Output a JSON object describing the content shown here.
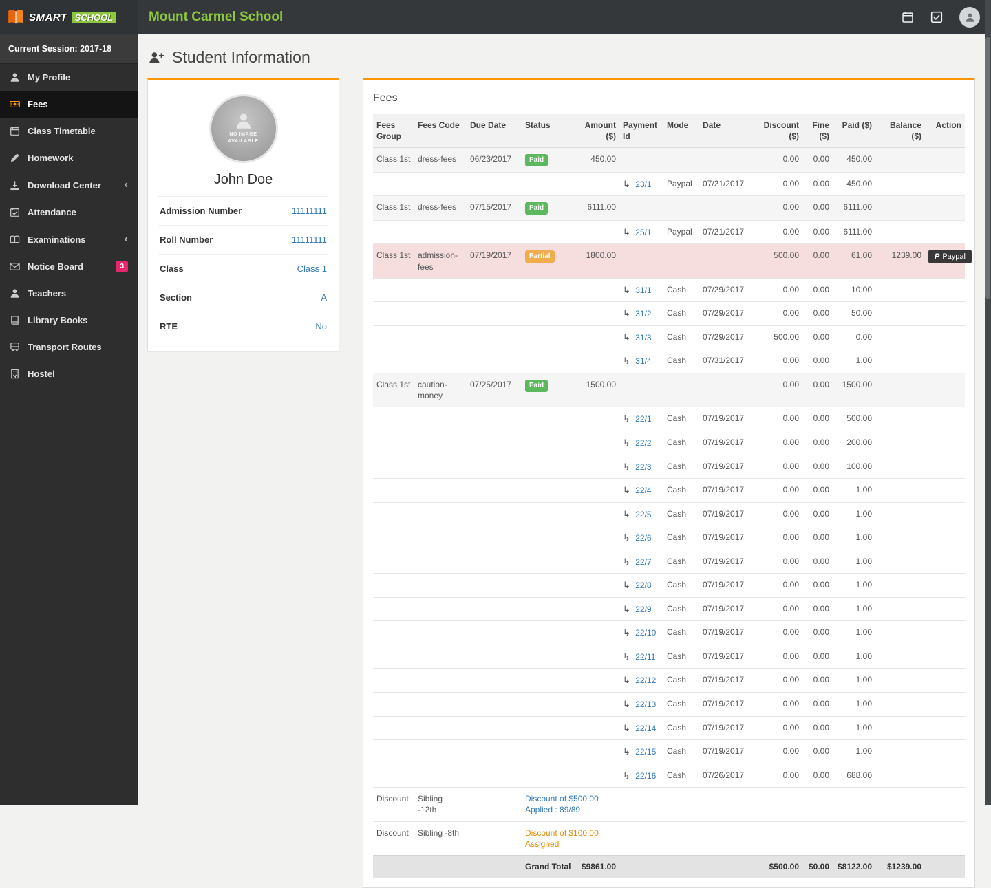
{
  "topbar": {
    "logo_smart": "SMART",
    "logo_school": "SCHOOL",
    "school_name": "Mount Carmel School",
    "icons": [
      "logo-book-icon",
      "calendar-icon",
      "tasks-icon",
      "user-avatar-icon"
    ]
  },
  "sidebar": {
    "session": "Current Session: 2017-18",
    "items": [
      {
        "label": "My Profile",
        "icon": "user-icon",
        "active": false,
        "chevron": false,
        "badge": ""
      },
      {
        "label": "Fees",
        "icon": "fees-icon",
        "active": true,
        "chevron": false,
        "badge": ""
      },
      {
        "label": "Class Timetable",
        "icon": "calendar-icon",
        "active": false,
        "chevron": false,
        "badge": ""
      },
      {
        "label": "Homework",
        "icon": "homework-icon",
        "active": false,
        "chevron": false,
        "badge": ""
      },
      {
        "label": "Download Center",
        "icon": "download-icon",
        "active": false,
        "chevron": true,
        "badge": ""
      },
      {
        "label": "Attendance",
        "icon": "attendance-icon",
        "active": false,
        "chevron": false,
        "badge": ""
      },
      {
        "label": "Examinations",
        "icon": "examinations-icon",
        "active": false,
        "chevron": true,
        "badge": ""
      },
      {
        "label": "Notice Board",
        "icon": "notice-icon",
        "active": false,
        "chevron": false,
        "badge": "3"
      },
      {
        "label": "Teachers",
        "icon": "teachers-icon",
        "active": false,
        "chevron": false,
        "badge": ""
      },
      {
        "label": "Library Books",
        "icon": "library-icon",
        "active": false,
        "chevron": false,
        "badge": ""
      },
      {
        "label": "Transport Routes",
        "icon": "transport-icon",
        "active": false,
        "chevron": false,
        "badge": ""
      },
      {
        "label": "Hostel",
        "icon": "hostel-icon",
        "active": false,
        "chevron": false,
        "badge": ""
      }
    ]
  },
  "page": {
    "title": "Student Information"
  },
  "student": {
    "no_image": "NO IMAGE AVAILABLE",
    "name": "John Doe",
    "fields": [
      {
        "label": "Admission Number",
        "value": "11111111"
      },
      {
        "label": "Roll Number",
        "value": "11111111"
      },
      {
        "label": "Class",
        "value": "Class 1"
      },
      {
        "label": "Section",
        "value": "A"
      },
      {
        "label": "RTE",
        "value": "No"
      }
    ]
  },
  "fees": {
    "title": "Fees",
    "headers": [
      "Fees Group",
      "Fees Code",
      "Due Date",
      "Status",
      "Amount ($)",
      "Payment Id",
      "Mode",
      "Date",
      "Discount ($)",
      "Fine ($)",
      "Paid ($)",
      "Balance ($)",
      "Action"
    ],
    "status_colors": {
      "paid": "#5cb85c",
      "partial": "#f0ad4e"
    },
    "rows": [
      {
        "type": "fee",
        "group": "Class 1st",
        "code": "dress-fees",
        "due_date": "06/23/2017",
        "status": "Paid",
        "status_kind": "paid",
        "amount": "450.00",
        "discount": "0.00",
        "fine": "0.00",
        "paid": "450.00",
        "balance": "",
        "action": "",
        "highlight": false
      },
      {
        "type": "payment",
        "payment_id": "23/1",
        "mode": "Paypal",
        "date": "07/21/2017",
        "discount": "0.00",
        "fine": "0.00",
        "paid": "450.00"
      },
      {
        "type": "fee",
        "group": "Class 1st",
        "code": "dress-fees",
        "due_date": "07/15/2017",
        "status": "Paid",
        "status_kind": "paid",
        "amount": "6111.00",
        "discount": "0.00",
        "fine": "0.00",
        "paid": "6111.00",
        "balance": "",
        "action": "",
        "highlight": false
      },
      {
        "type": "payment",
        "payment_id": "25/1",
        "mode": "Paypal",
        "date": "07/21/2017",
        "discount": "0.00",
        "fine": "0.00",
        "paid": "6111.00"
      },
      {
        "type": "fee",
        "group": "Class 1st",
        "code": "admission-fees",
        "due_date": "07/19/2017",
        "status": "Partial",
        "status_kind": "partial",
        "amount": "1800.00",
        "discount": "500.00",
        "fine": "0.00",
        "paid": "61.00",
        "balance": "1239.00",
        "action": "Paypal",
        "highlight": true
      },
      {
        "type": "payment",
        "payment_id": "31/1",
        "mode": "Cash",
        "date": "07/29/2017",
        "discount": "0.00",
        "fine": "0.00",
        "paid": "10.00"
      },
      {
        "type": "payment",
        "payment_id": "31/2",
        "mode": "Cash",
        "date": "07/29/2017",
        "discount": "0.00",
        "fine": "0.00",
        "paid": "50.00"
      },
      {
        "type": "payment",
        "payment_id": "31/3",
        "mode": "Cash",
        "date": "07/29/2017",
        "discount": "500.00",
        "fine": "0.00",
        "paid": "0.00"
      },
      {
        "type": "payment",
        "payment_id": "31/4",
        "mode": "Cash",
        "date": "07/31/2017",
        "discount": "0.00",
        "fine": "0.00",
        "paid": "1.00"
      },
      {
        "type": "fee",
        "group": "Class 1st",
        "code": "caution-money",
        "due_date": "07/25/2017",
        "status": "Paid",
        "status_kind": "paid",
        "amount": "1500.00",
        "discount": "0.00",
        "fine": "0.00",
        "paid": "1500.00",
        "balance": "",
        "action": "",
        "highlight": false
      },
      {
        "type": "payment",
        "payment_id": "22/1",
        "mode": "Cash",
        "date": "07/19/2017",
        "discount": "0.00",
        "fine": "0.00",
        "paid": "500.00"
      },
      {
        "type": "payment",
        "payment_id": "22/2",
        "mode": "Cash",
        "date": "07/19/2017",
        "discount": "0.00",
        "fine": "0.00",
        "paid": "200.00"
      },
      {
        "type": "payment",
        "payment_id": "22/3",
        "mode": "Cash",
        "date": "07/19/2017",
        "discount": "0.00",
        "fine": "0.00",
        "paid": "100.00"
      },
      {
        "type": "payment",
        "payment_id": "22/4",
        "mode": "Cash",
        "date": "07/19/2017",
        "discount": "0.00",
        "fine": "0.00",
        "paid": "1.00"
      },
      {
        "type": "payment",
        "payment_id": "22/5",
        "mode": "Cash",
        "date": "07/19/2017",
        "discount": "0.00",
        "fine": "0.00",
        "paid": "1.00"
      },
      {
        "type": "payment",
        "payment_id": "22/6",
        "mode": "Cash",
        "date": "07/19/2017",
        "discount": "0.00",
        "fine": "0.00",
        "paid": "1.00"
      },
      {
        "type": "payment",
        "payment_id": "22/7",
        "mode": "Cash",
        "date": "07/19/2017",
        "discount": "0.00",
        "fine": "0.00",
        "paid": "1.00"
      },
      {
        "type": "payment",
        "payment_id": "22/8",
        "mode": "Cash",
        "date": "07/19/2017",
        "discount": "0.00",
        "fine": "0.00",
        "paid": "1.00"
      },
      {
        "type": "payment",
        "payment_id": "22/9",
        "mode": "Cash",
        "date": "07/19/2017",
        "discount": "0.00",
        "fine": "0.00",
        "paid": "1.00"
      },
      {
        "type": "payment",
        "payment_id": "22/10",
        "mode": "Cash",
        "date": "07/19/2017",
        "discount": "0.00",
        "fine": "0.00",
        "paid": "1.00"
      },
      {
        "type": "payment",
        "payment_id": "22/11",
        "mode": "Cash",
        "date": "07/19/2017",
        "discount": "0.00",
        "fine": "0.00",
        "paid": "1.00"
      },
      {
        "type": "payment",
        "payment_id": "22/12",
        "mode": "Cash",
        "date": "07/19/2017",
        "discount": "0.00",
        "fine": "0.00",
        "paid": "1.00"
      },
      {
        "type": "payment",
        "payment_id": "22/13",
        "mode": "Cash",
        "date": "07/19/2017",
        "discount": "0.00",
        "fine": "0.00",
        "paid": "1.00"
      },
      {
        "type": "payment",
        "payment_id": "22/14",
        "mode": "Cash",
        "date": "07/19/2017",
        "discount": "0.00",
        "fine": "0.00",
        "paid": "1.00"
      },
      {
        "type": "payment",
        "payment_id": "22/15",
        "mode": "Cash",
        "date": "07/19/2017",
        "discount": "0.00",
        "fine": "0.00",
        "paid": "1.00"
      },
      {
        "type": "payment",
        "payment_id": "22/16",
        "mode": "Cash",
        "date": "07/26/2017",
        "discount": "0.00",
        "fine": "0.00",
        "paid": "688.00"
      },
      {
        "type": "discount",
        "group": "Discount",
        "code": "Sibling -12th",
        "text": "Discount of $500.00 Applied : 89/89",
        "color": "blue"
      },
      {
        "type": "discount",
        "group": "Discount",
        "code": "Sibling -8th",
        "text": "Discount of $100.00 Assigned",
        "color": "orange"
      },
      {
        "type": "total",
        "label": "Grand Total",
        "amount": "$9861.00",
        "discount": "$500.00",
        "fine": "$0.00",
        "paid": "$8122.00",
        "balance": "$1239.00"
      }
    ]
  }
}
